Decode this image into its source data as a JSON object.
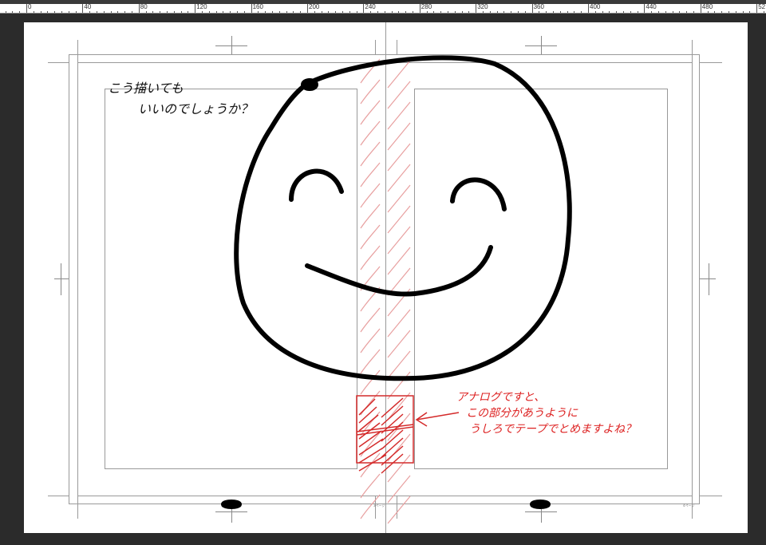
{
  "ruler": {
    "labels": [
      "0",
      "40",
      "80",
      "120",
      "160",
      "200",
      "240",
      "280",
      "320",
      "360",
      "400",
      "440",
      "480",
      "52"
    ]
  },
  "notes": {
    "question_lines": [
      "こう描いても",
      "いいのでしょうか？"
    ],
    "tape_lines": [
      "アナログですと、",
      "この部分があうように",
      "うしろでテープでとめますよね？"
    ]
  },
  "page_numbers": {
    "left": "3ページ",
    "right": "4ページ"
  },
  "colors": {
    "ink": "#000000",
    "annotation": "#d42a2a",
    "guide": "#e8a0a0",
    "background": "#2b2b2b"
  }
}
